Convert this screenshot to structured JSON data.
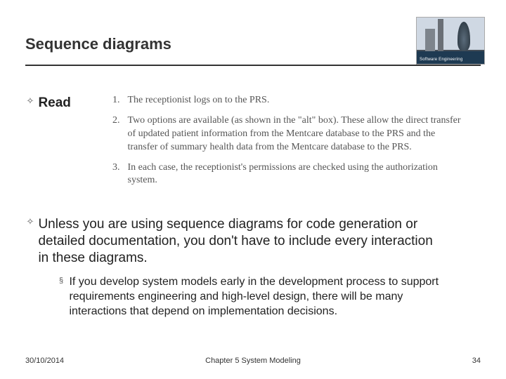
{
  "title": "Sequence diagrams",
  "logo": {
    "caption": "Software Engineering"
  },
  "bullets": {
    "read": "Read",
    "paragraph": "Unless you are using sequence diagrams for code generation or detailed documentation, you don't have to include every interaction in these diagrams.",
    "sub": "If you develop system models early in the development process to support requirements engineering and high-level design, there will be many interactions that depend on implementation decisions."
  },
  "numbered": {
    "n1": "1.",
    "t1": "The receptionist logs on to the PRS.",
    "n2": "2.",
    "t2": "Two options are available (as shown in the \"alt\" box). These allow the direct transfer of updated patient information from the Mentcare database to the PRS and the transfer of summary health data from the Mentcare database to the PRS.",
    "n3": "3.",
    "t3": "In each case, the receptionist's permissions are checked using the authorization system."
  },
  "footer": {
    "date": "30/10/2014",
    "center": "Chapter 5 System Modeling",
    "page": "34"
  },
  "glyphs": {
    "diamond": "✧",
    "square": "§"
  }
}
